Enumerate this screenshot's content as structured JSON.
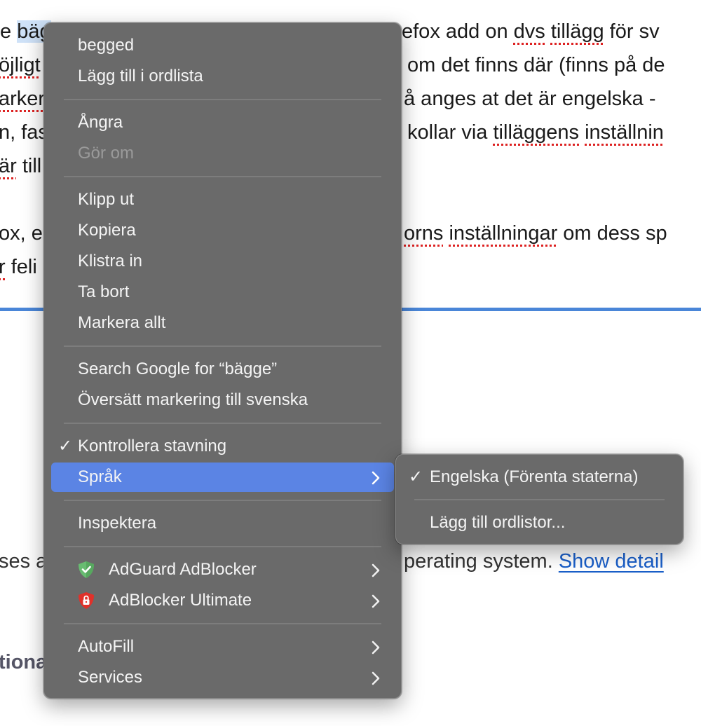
{
  "background": {
    "lines": [
      {
        "parts": [
          "e ",
          "bäg",
          "",
          "efox add on ",
          "dvs",
          " ",
          "tillägg",
          " för sv"
        ]
      },
      {
        "parts": [
          "öjligt",
          "",
          "om det finns där (finns på de"
        ]
      },
      {
        "parts": [
          "arker",
          "",
          "å anges at det är engelska -"
        ]
      },
      {
        "parts": [
          "n, fas",
          "",
          "kollar via ",
          "tilläggens",
          " ",
          "inställnin"
        ]
      },
      {
        "parts": [
          "är",
          " till"
        ]
      },
      {
        "parts": [
          "ox, e",
          "",
          "orns",
          " ",
          "inställningar",
          " om dess sp"
        ]
      },
      {
        "parts": [
          "r",
          " feli"
        ]
      }
    ],
    "os_line_left": "ses a",
    "os_line_right": "perating system.",
    "show_details": "Show detail",
    "bold_left": "tiona"
  },
  "menu": {
    "spelling_suggestion": "begged",
    "add_to_dictionary": "Lägg till i ordlista",
    "undo": "Ångra",
    "redo": "Gör om",
    "cut": "Klipp ut",
    "copy": "Kopiera",
    "paste": "Klistra in",
    "delete": "Ta bort",
    "select_all": "Markera allt",
    "search_google": "Search Google for “bägge”",
    "translate": "Översätt markering till svenska",
    "check_spelling": "Kontrollera stavning",
    "language": "Språk",
    "inspect": "Inspektera",
    "adguard": "AdGuard AdBlocker",
    "adblocker_ultimate": "AdBlocker Ultimate",
    "autofill": "AutoFill",
    "services": "Services",
    "checkmark": "✓"
  },
  "submenu": {
    "english_us": "Engelska (Förenta staterna)",
    "add_dictionaries": "Lägg till ordlistor..."
  },
  "colors": {
    "menu_bg": "#6a6a6a",
    "highlight": "#5b84e4",
    "adguard_green": "#68bc71",
    "adblocker_red": "#e0312a",
    "link_blue": "#1a5fc9"
  }
}
